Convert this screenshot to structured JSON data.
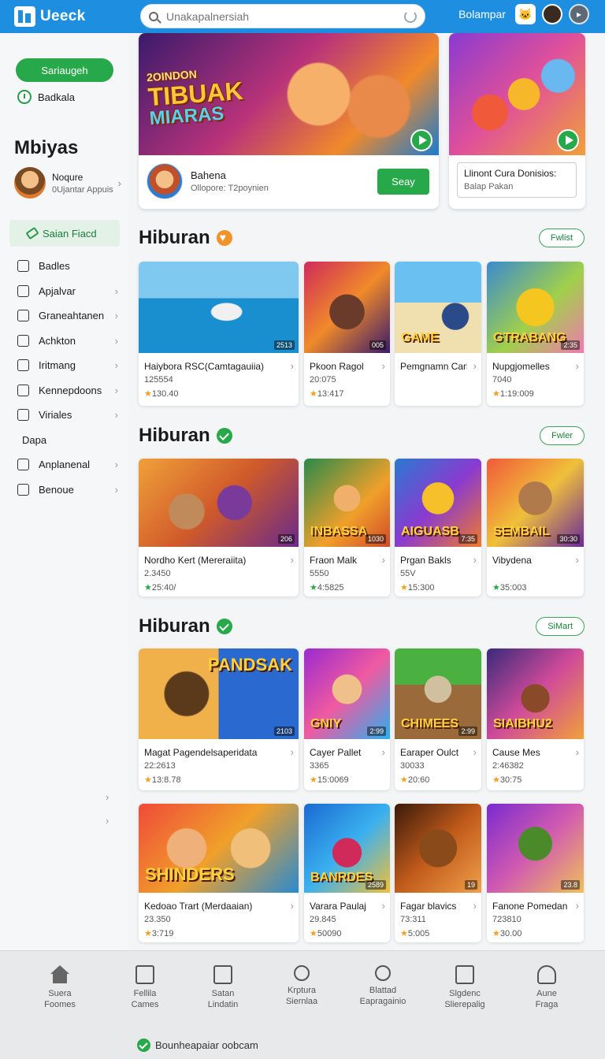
{
  "header": {
    "logo": "Ueeck",
    "search_placeholder": "Unakapalnersiah",
    "right_link": "Bolampar"
  },
  "sidebar": {
    "primary_button": "Sariaugeh",
    "check_item": "Badkala",
    "title": "Mbiyas",
    "profile": {
      "name": "Noqure",
      "sub": "0Ujantar Appuis"
    },
    "active_item": "Saian Fiacd",
    "items": [
      {
        "label": "Badles",
        "icon": true,
        "chevron": false
      },
      {
        "label": "Apjalvar",
        "icon": true,
        "chevron": true
      },
      {
        "label": "Graneahtanen",
        "icon": true,
        "chevron": true
      },
      {
        "label": "Achkton",
        "icon": true,
        "chevron": true
      },
      {
        "label": "Iritmang",
        "icon": true,
        "chevron": true
      },
      {
        "label": "Kennepdoons",
        "icon": true,
        "chevron": true
      },
      {
        "label": "Viriales",
        "icon": true,
        "chevron": true
      },
      {
        "label": "Dapa",
        "icon": false,
        "chevron": false
      },
      {
        "label": "Anplanenal",
        "icon": true,
        "chevron": true
      },
      {
        "label": "Benoue",
        "icon": true,
        "chevron": true
      }
    ]
  },
  "featured": {
    "main": {
      "art_small": "2OINDON",
      "art_title": "TIBUAK",
      "art_sub": "MIARAS",
      "title": "Bahena",
      "sub": "Ollopore: T2poynien",
      "button": "Seay"
    },
    "side": {
      "title": "Llinont Cura Donisios:",
      "sub": "Balap Pakan"
    }
  },
  "sections": [
    {
      "title": "Hiburan",
      "badge": "heart",
      "pill": "Fwlist",
      "cards": [
        {
          "title": "Haiybora RSC(Camtagauiia)",
          "line": "125554",
          "rating": "130.40",
          "art": "",
          "corner": "2513"
        },
        {
          "title": "Pkoon Ragol",
          "line": "20:075",
          "rating": "13:417",
          "art": "",
          "corner": "005"
        },
        {
          "title": "Pemgnamn Carlalu",
          "line": "",
          "rating": "",
          "art": "GAME",
          "corner": ""
        },
        {
          "title": "Nupgjomelles",
          "line": "7040",
          "rating": "1:19:009",
          "art": "GTRABANG",
          "corner": "2:35"
        }
      ]
    },
    {
      "title": "Hiburan",
      "badge": "check",
      "pill": "Fwler",
      "cards": [
        {
          "title": "Nordho Kert (Mereraiita)",
          "line": "2.3450",
          "rating": "25:40/",
          "art": "",
          "corner": "206"
        },
        {
          "title": "Fraon Malk",
          "line": "5550",
          "rating": "4:5825",
          "art": "INBASSA",
          "corner": "1030"
        },
        {
          "title": "Prgan Bakls",
          "line": "55V",
          "rating": "15:300",
          "art": "AIGUASB",
          "corner": "7:35"
        },
        {
          "title": "Vibydena",
          "line": "",
          "rating": "35:003",
          "art": "SEMBAIL",
          "corner": "30:30"
        }
      ]
    },
    {
      "title": "Hiburan",
      "badge": "check",
      "pill": "SiMart",
      "cards": [
        {
          "title": "Magat Pagendelsaperidata",
          "line": "22:2613",
          "rating": "13:8.78",
          "art": "PANDSAK",
          "corner": "2103"
        },
        {
          "title": "Cayer Pallet",
          "line": "3365",
          "rating": "15:0069",
          "art": "GNIY",
          "corner": "2:99"
        },
        {
          "title": "Earaper Oulct",
          "line": "30033",
          "rating": "20:60",
          "art": "CHIMEES",
          "corner": "2:99"
        },
        {
          "title": "Cause Mes",
          "line": "2:46382",
          "rating": "30:75",
          "art": "SIAIBHU2",
          "corner": ""
        }
      ]
    },
    {
      "title": "",
      "badge": "",
      "pill": "",
      "cards": [
        {
          "title": "Kedoao Trart (Merdaaian)",
          "line": "23.350",
          "rating": "3:719",
          "art": "SHINDERS",
          "corner": ""
        },
        {
          "title": "Varara Paulaj",
          "line": "29.845",
          "rating": "50090",
          "art": "BANRDES",
          "corner": "2589"
        },
        {
          "title": "Fagar blavics",
          "line": "73:311",
          "rating": "5:005",
          "art": "",
          "corner": "19"
        },
        {
          "title": "Fanone Pomedan",
          "line": "723810",
          "rating": "30.00",
          "art": "",
          "corner": "23.8"
        }
      ]
    }
  ],
  "bottom_nav": [
    {
      "l1": "Suera",
      "l2": "Foomes",
      "icon": "home-icon"
    },
    {
      "l1": "Fellila",
      "l2": "Cames",
      "icon": "games-icon"
    },
    {
      "l1": "Satan",
      "l2": "Lindatin",
      "icon": "document-icon"
    },
    {
      "l1": "Krptura",
      "l2": "Siernlaa",
      "icon": "search-icon"
    },
    {
      "l1": "Blattad",
      "l2": "Eapragainio",
      "icon": "clock-icon"
    },
    {
      "l1": "Slgdenc",
      "l2": "Slierepalig",
      "icon": "message-icon"
    },
    {
      "l1": "Aune",
      "l2": "Fraga",
      "icon": "user-icon"
    }
  ],
  "footer_text": "Bounheapaiar oobcam"
}
